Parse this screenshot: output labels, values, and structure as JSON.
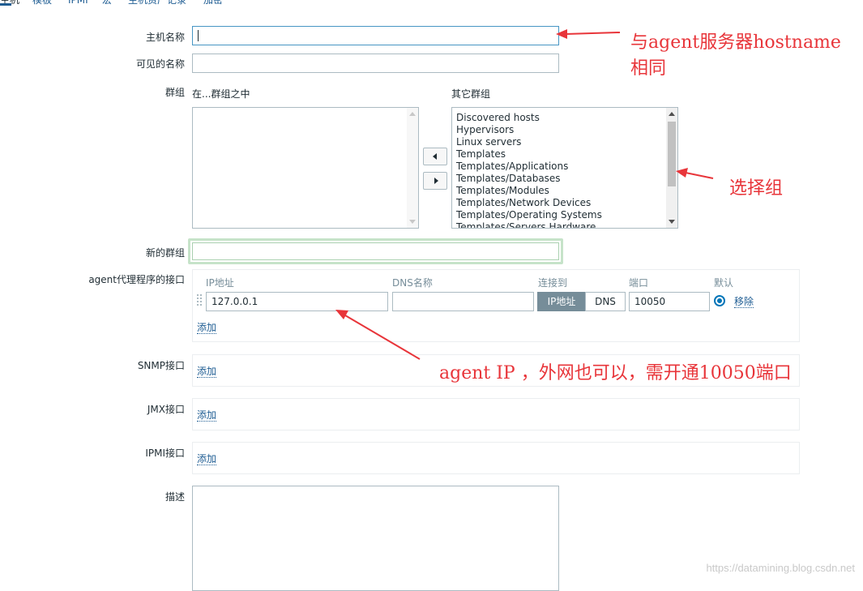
{
  "tabs": [
    {
      "label": "主机",
      "active": true
    },
    {
      "label": "模板",
      "active": false
    },
    {
      "label": "IPMI",
      "active": false
    },
    {
      "label": "宏",
      "active": false
    },
    {
      "label": "主机资产记录",
      "active": false
    },
    {
      "label": "加密",
      "active": false
    }
  ],
  "form": {
    "host_name_label": "主机名称",
    "host_name_value": "",
    "visible_name_label": "可见的名称",
    "visible_name_value": "",
    "groups_label": "群组",
    "in_groups_label": "在...群组之中",
    "other_groups_label": "其它群组",
    "other_groups": [
      "Discovered hosts",
      "Hypervisors",
      "Linux servers",
      "Templates",
      "Templates/Applications",
      "Templates/Databases",
      "Templates/Modules",
      "Templates/Network Devices",
      "Templates/Operating Systems",
      "Templates/Servers Hardware"
    ],
    "new_group_label": "新的群组",
    "new_group_value": "",
    "agent_interfaces_label": "agent代理程序的接口",
    "agent_columns": {
      "ip": "IP地址",
      "dns": "DNS名称",
      "connect": "连接到",
      "port": "端口",
      "default": "默认"
    },
    "agent_ip_value": "127.0.0.1",
    "agent_dns_value": "",
    "connect_options": [
      "IP地址",
      "DNS"
    ],
    "connect_selected": "IP地址",
    "agent_port_value": "10050",
    "remove_label": "移除",
    "add_label": "添加",
    "snmp_label": "SNMP接口",
    "jmx_label": "JMX接口",
    "ipmi_label": "IPMI接口",
    "description_label": "描述",
    "description_value": ""
  },
  "annotations": {
    "hostname_note_line1": "与agent服务器hostname",
    "hostname_note_line2": "相同",
    "group_note": "选择组",
    "ip_note": "agent IP ，外网也可以，需开通10050端口",
    "color": "#e8353a"
  },
  "watermark": "https://datamining.blog.csdn.net"
}
